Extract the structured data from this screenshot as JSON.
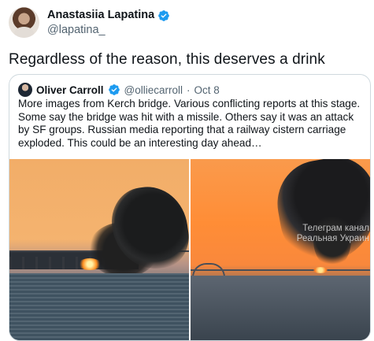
{
  "author": {
    "name": "Anastasiia Lapatina",
    "handle": "@lapatina_"
  },
  "tweet": {
    "text": "Regardless of the reason, this deserves a drink"
  },
  "quote": {
    "author_name": "Oliver Carroll",
    "handle": "@olliecarroll",
    "separator": "·",
    "date": "Oct 8",
    "text": "More images from Kerch bridge. Various conflicting reports at this stage. Some say the bridge was hit with a missile. Others say it was an attack by SF groups. Russian media reporting that a railway cistern carriage exploded.  This could be an interesting day ahead…"
  },
  "media": {
    "right_watermark": "Телеграм канал\nРеальная Украин"
  },
  "colors": {
    "verified": "#1d9bf0",
    "secondary_text": "#536471",
    "border": "#cfd9de"
  },
  "icons": {
    "verified": "verified-badge-icon"
  }
}
